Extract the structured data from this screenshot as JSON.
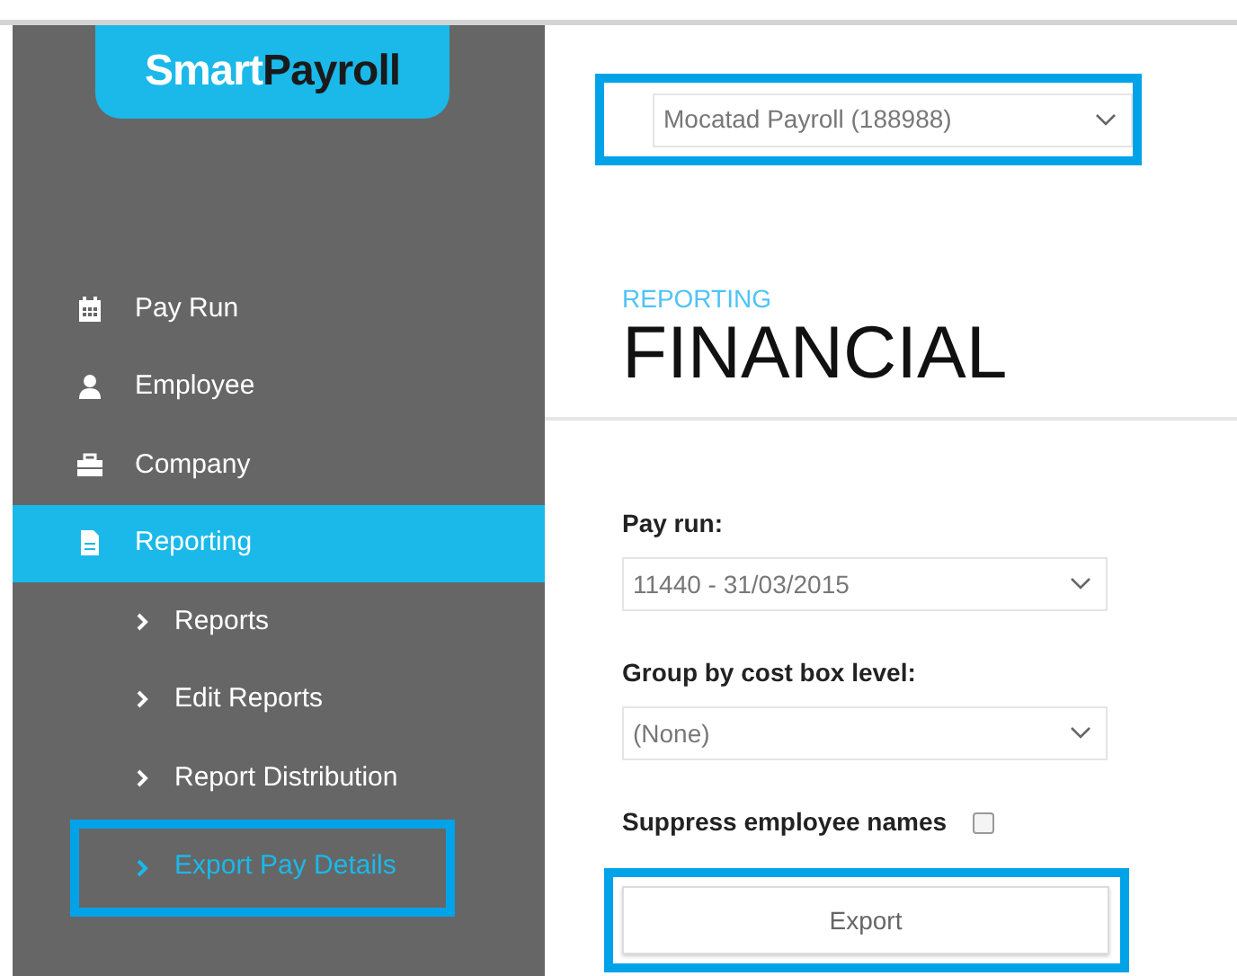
{
  "sidebar": {
    "logo": [
      {
        "text": "Smart",
        "kind": "light"
      },
      {
        "text": "Payroll",
        "kind": "dark"
      }
    ],
    "items": [
      {
        "label": "Pay Run",
        "kind": "calendar",
        "selected": false
      },
      {
        "label": "Employee",
        "kind": "person",
        "selected": false
      },
      {
        "label": "Company",
        "kind": "briefcase",
        "selected": false
      },
      {
        "label": "Reporting",
        "kind": "document",
        "selected": true,
        "children": [
          {
            "label": "Reports",
            "selected": false,
            "highlighted": false
          },
          {
            "label": "Edit Reports",
            "selected": false,
            "highlighted": false
          },
          {
            "label": "Report Distribution",
            "selected": false,
            "highlighted": false
          },
          {
            "label": "Export Pay Details",
            "selected": true,
            "highlighted": true
          }
        ]
      }
    ]
  },
  "company_select": {
    "value": "Mocatad Payroll (188988)",
    "highlighted": true
  },
  "header": {
    "section": "REPORTING",
    "title": "FINANCIAL"
  },
  "form": {
    "fields": [
      {
        "kind": "select",
        "label": "Pay run:",
        "value": "11440 - 31/03/2015"
      },
      {
        "kind": "select",
        "label": "Group by cost box level:",
        "value": "(None)"
      },
      {
        "kind": "checkbox",
        "label": "Suppress employee names",
        "checked": false
      }
    ],
    "button": {
      "label": "Export",
      "highlighted": true
    }
  }
}
